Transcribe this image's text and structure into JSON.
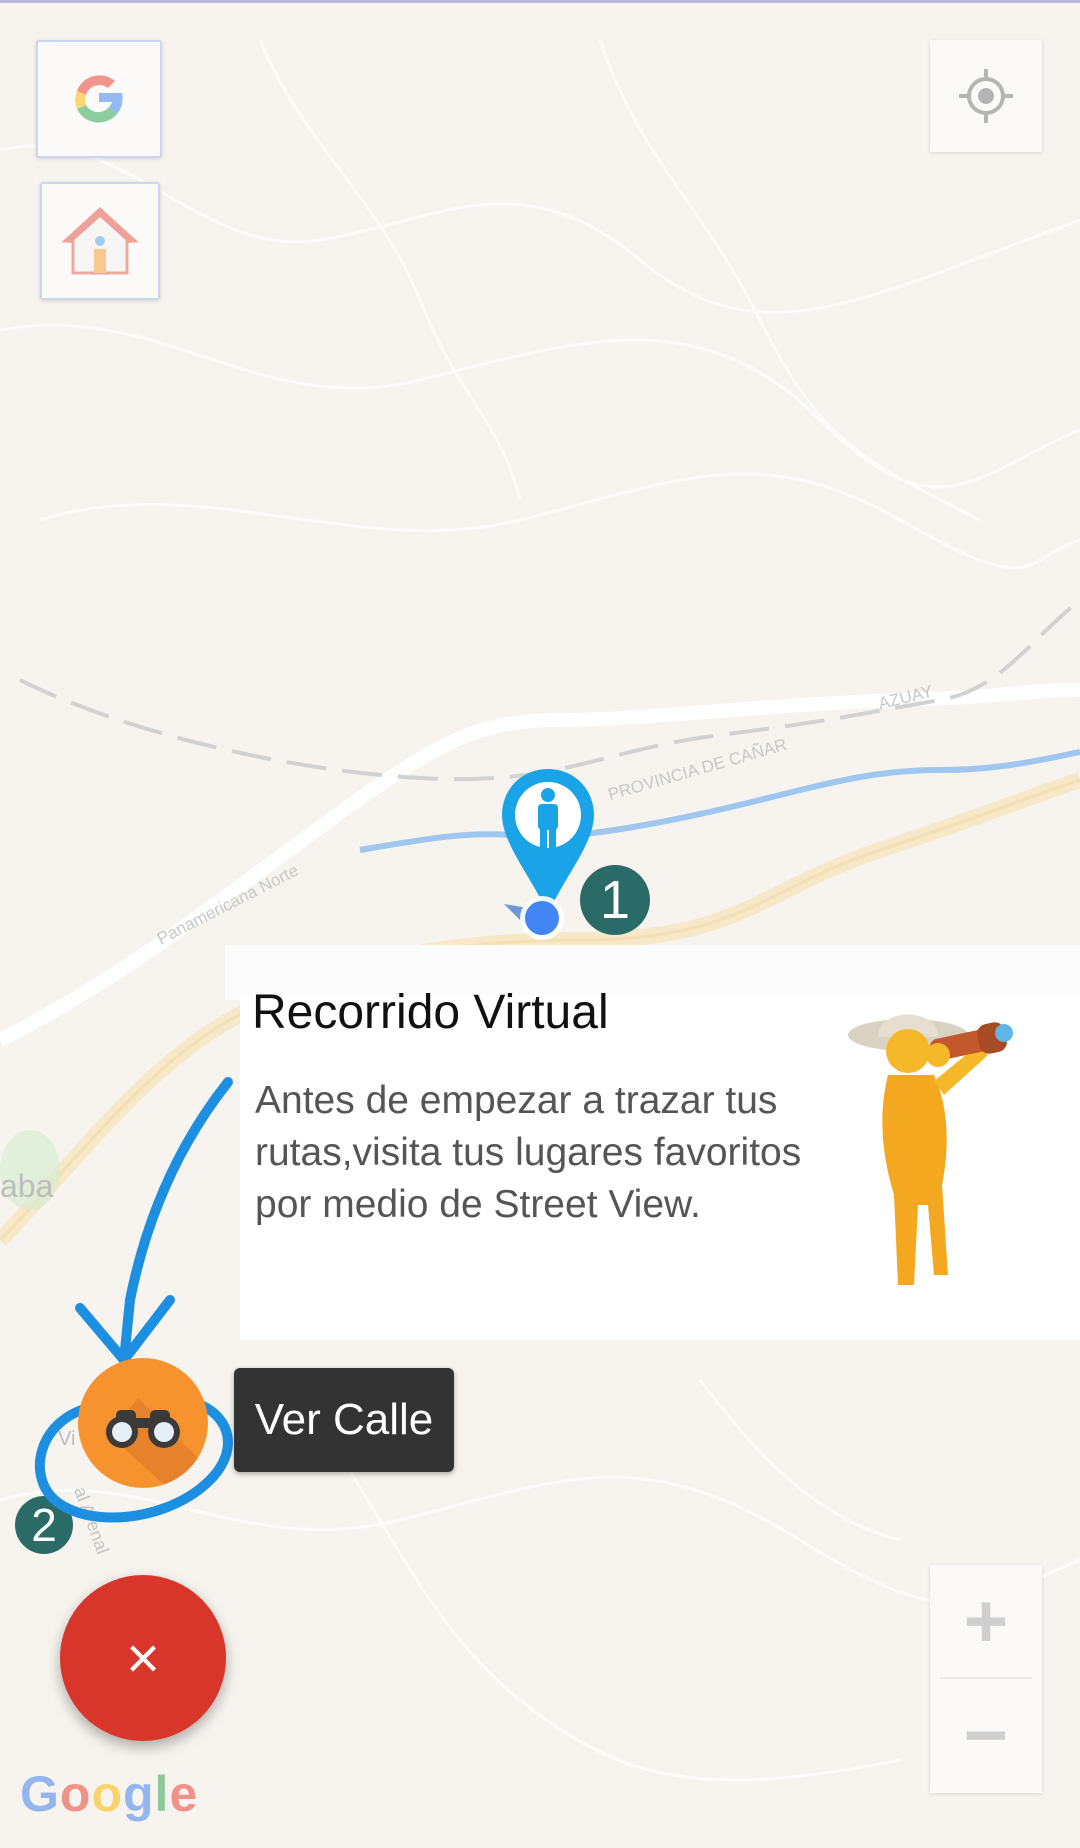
{
  "map": {
    "labels": {
      "azuay": "AZUAY",
      "provincia": "PROVINCIA DE CAÑAR",
      "panamericana": "Panamericana Norte",
      "aba": "aba",
      "vi": "Vi",
      "arenal": "al Arenal"
    },
    "google_logo": "Google",
    "zoom_in": "+",
    "zoom_out": "−"
  },
  "tutorial": {
    "title": "Recorrido Virtual",
    "text": "Antes de empezar a trazar tus rutas,visita tus lugares favoritos por medio de Street View.",
    "tooltip": "Ver Calle",
    "step1": "1",
    "step2": "2"
  },
  "fab": {
    "close": "×"
  },
  "colors": {
    "fab_orange": "#f7932f",
    "fab_red": "#d8362b",
    "pin_blue": "#1aa3e6",
    "annotation_blue": "#1d8fe0",
    "badge_teal": "#2a6b68",
    "location_dot": "#4285f4"
  },
  "icons": [
    "google-g-icon",
    "home-icon",
    "my-location-icon",
    "person-pin-icon",
    "binoculars-icon",
    "explorer-figure-icon",
    "close-icon"
  ]
}
